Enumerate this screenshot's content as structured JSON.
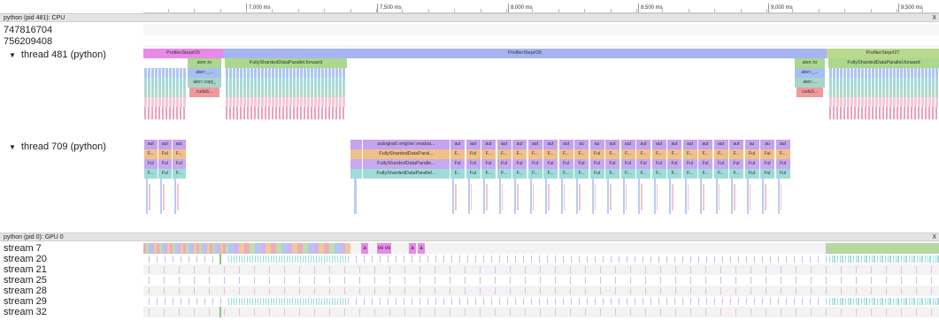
{
  "timeline": {
    "ticks": [
      "7,000 ms",
      "7,500 ms",
      "8,000 ms",
      "8,500 ms",
      "9,000 ms",
      "9,500 ms"
    ]
  },
  "cpu_process": {
    "title": "python (pid 481): CPU",
    "close": "X",
    "counters": [
      "747816704",
      "756209408"
    ],
    "thread_481": {
      "label": "thread 481 (python)",
      "slices": {
        "profiler_step_25": "ProfilerStep#25",
        "profiler_step_26": "ProfilerStep#26",
        "profiler_step_27": "ProfilerStep#27",
        "fsdp_forward_a": "FullyShardedDataParallel.forward",
        "fsdp_forward_b": "FullyShardedDataParallel.forward",
        "aten_to_a": "aten::to",
        "aten_to_b": "aten::_...",
        "aten_copy_a": "aten::copy_",
        "cuda_a": "cudaS...",
        "aten_to_c": "aten::to",
        "aten_to_d": "aten::_...",
        "aten_copy_b": "aten:...",
        "cuda_b": "cudaS..."
      }
    },
    "thread_709": {
      "label": "thread 709 (python)",
      "slices": {
        "autograd": "autograd::engine::evalua...",
        "fsdp_a": "FullyShardedDataParal...",
        "fsdp_b": "FullyShardedDataParalle...",
        "fsdp_c": "FullyShardedDataParallel..."
      },
      "left_group": [
        [
          "aut",
          "aut",
          "aut"
        ],
        [
          "F...",
          "Ful",
          "F..."
        ],
        [
          "Ful",
          "Ful",
          "Ful"
        ],
        [
          "F...",
          "Ful",
          "F..."
        ]
      ],
      "right_group": [
        [
          "aut",
          "aut",
          "aut",
          "aut",
          "aut",
          "aut",
          "aut",
          "aut",
          "au",
          "au",
          "aut",
          "aut",
          "aut",
          "aut",
          "aut",
          "aut",
          "aut",
          "aut",
          "aut",
          "au",
          "au",
          "aut"
        ],
        [
          "F...",
          "Ful",
          "F...",
          "F...",
          "F...",
          "F...",
          "F...",
          "F...",
          "F...",
          "Ful",
          "F...",
          "F...",
          "F...",
          "F...",
          "F...",
          "F...",
          "F...",
          "F...",
          "F...",
          "Ful",
          "Ful",
          "F..."
        ],
        [
          "Ful",
          "Ful",
          "Ful",
          "Ful",
          "Ful",
          "Ful",
          "Ful",
          "Ful",
          "Ful",
          "Ful",
          "Ful",
          "Ful",
          "Ful",
          "Ful",
          "Ful",
          "Ful",
          "Ful",
          "Ful",
          "Ful",
          "Ful",
          "Ful",
          "Ful"
        ],
        [
          "F...",
          "Ful",
          "F...",
          "F...",
          "F...",
          "F...",
          "F...",
          "F...",
          "F...",
          "Ful",
          "F...",
          "F...",
          "F...",
          "F...",
          "F...",
          "F...",
          "F...",
          "F...",
          "F...",
          "Ful",
          "Ful",
          "Ful"
        ]
      ]
    }
  },
  "gpu_process": {
    "title": "python (pid 0): GPU 0",
    "close": "X",
    "streams": [
      "stream 7",
      "stream 20",
      "stream 21",
      "stream 25",
      "stream 28",
      "stream 29",
      "stream 32"
    ],
    "stream7_labels": [
      "a",
      "vo",
      "vo",
      "a",
      "a"
    ]
  },
  "colors": {
    "profiler_step_25": "#e88be8",
    "profiler_step_26": "#a7b4f2",
    "profiler_step_27": "#b9d98d",
    "fsdp_forward": "#a9d88e",
    "aten_to": "#a7d6c6",
    "aten_underscore": "#a6bff2",
    "aten_copy": "#9fd6d6",
    "cuda": "#f19a9a",
    "autograd": "#c4a3f0",
    "fsdp_orange": "#f0c089",
    "fsdp_purple": "#c8a8f0",
    "fsdp_teal": "#9edcda"
  }
}
